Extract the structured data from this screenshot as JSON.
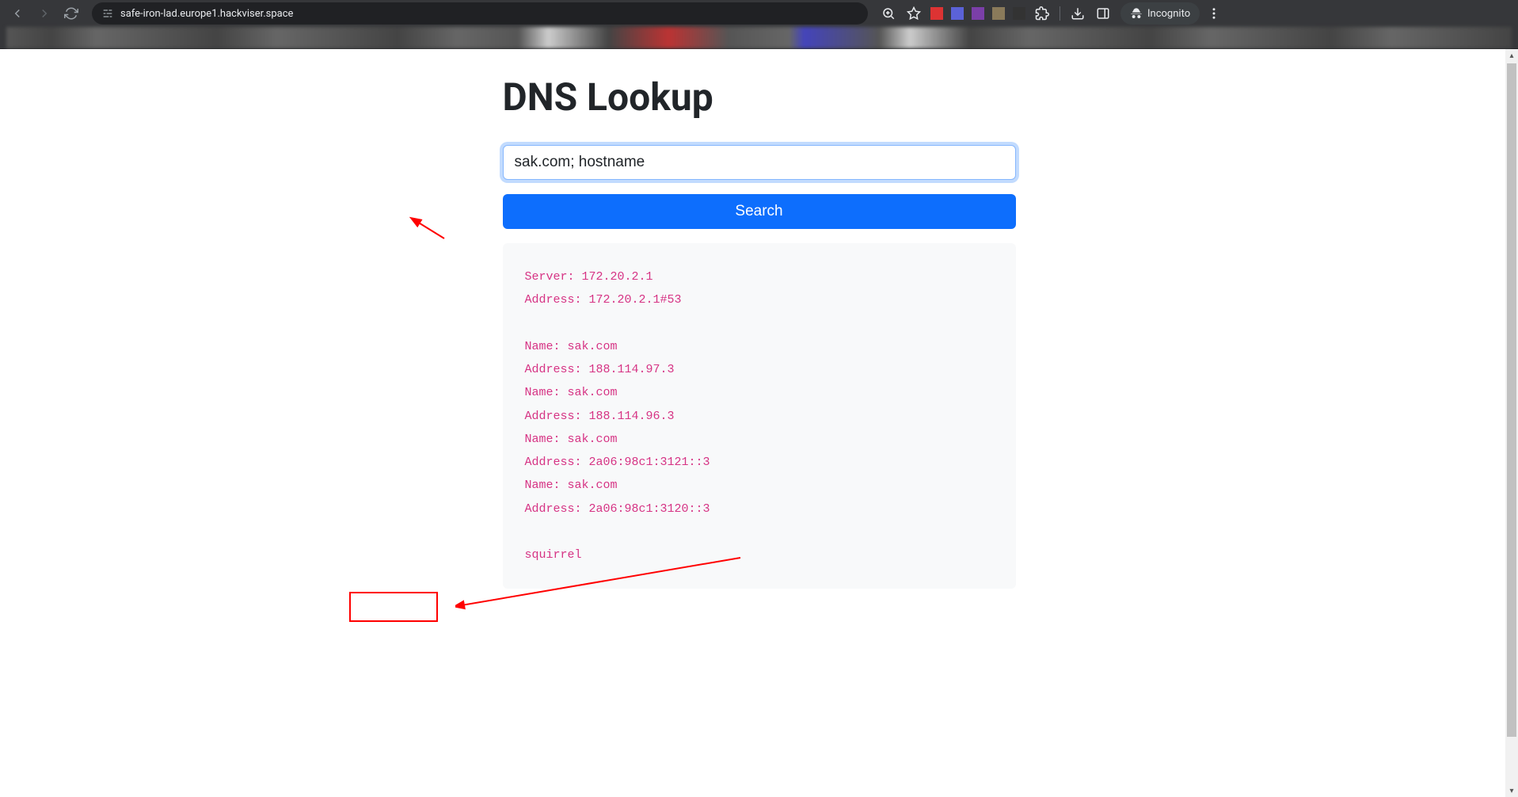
{
  "browser": {
    "url": "safe-iron-lad.europe1.hackviser.space",
    "incognito_label": "Incognito"
  },
  "page": {
    "title": "DNS Lookup",
    "input_value": "sak.com; hostname",
    "search_label": "Search",
    "output": "Server: 172.20.2.1\nAddress: 172.20.2.1#53\n\nName: sak.com\nAddress: 188.114.97.3\nName: sak.com\nAddress: 188.114.96.3\nName: sak.com\nAddress: 2a06:98c1:3121::3\nName: sak.com\nAddress: 2a06:98c1:3120::3\n\nsquirrel"
  },
  "annotations": {
    "highlight_word": "squirrel"
  }
}
